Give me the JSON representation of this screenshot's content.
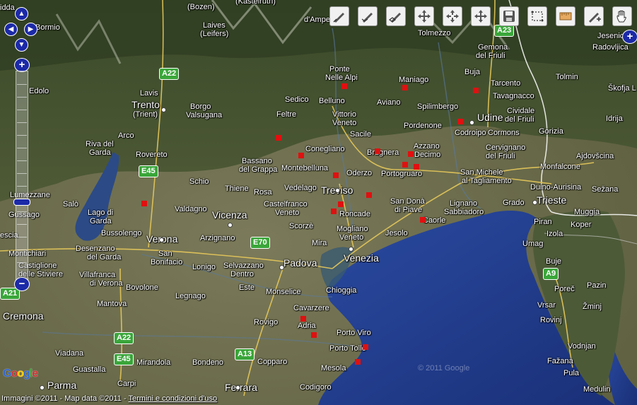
{
  "controls": {
    "pan_up": "▲",
    "pan_left": "◀",
    "pan_right": "▶",
    "pan_down": "▼",
    "zoom_in": "+",
    "zoom_out": "−",
    "overview_toggle": "+"
  },
  "toolbar_icons": [
    "draw-line-icon",
    "draw-polyline-icon",
    "draw-polygon-icon",
    "move-icon",
    "move-vertex-icon",
    "pan-icon",
    "save-icon",
    "select-box-icon",
    "ruler-icon",
    "add-point-icon",
    "hand-icon"
  ],
  "cities": [
    {
      "id": "bozen",
      "name": "(Bozen)"
    },
    {
      "id": "kastelruth",
      "name": "(Kastelruth)"
    },
    {
      "id": "idda",
      "name": "idda"
    },
    {
      "id": "laives",
      "name": "Laives"
    },
    {
      "id": "leifers",
      "name": "(Leifers)"
    },
    {
      "id": "ampezzo",
      "name": "d'Ampezzo"
    },
    {
      "id": "bormio",
      "name": "Bormio"
    },
    {
      "id": "tolmezzo",
      "name": "Tolmezzo"
    },
    {
      "id": "gemona",
      "name": "Gemona"
    },
    {
      "id": "delfriuli",
      "name": "del Friuli"
    },
    {
      "id": "jesenice",
      "name": "Jesenice"
    },
    {
      "id": "radovljica",
      "name": "Radovljica"
    },
    {
      "id": "ponte",
      "name": "Ponte"
    },
    {
      "id": "nellealpi",
      "name": "Nelle Alpi"
    },
    {
      "id": "maniago",
      "name": "Maniago"
    },
    {
      "id": "buja",
      "name": "Buja"
    },
    {
      "id": "tarcento",
      "name": "Tarcento"
    },
    {
      "id": "tolmin",
      "name": "Tolmin"
    },
    {
      "id": "tavagnacco",
      "name": "Tavagnacco"
    },
    {
      "id": "skofja",
      "name": "Škofja L"
    },
    {
      "id": "edolo",
      "name": "Edolo"
    },
    {
      "id": "lavis",
      "name": "Lavis"
    },
    {
      "id": "trento",
      "name": "Trento"
    },
    {
      "id": "trient",
      "name": "(Trient)"
    },
    {
      "id": "borgo",
      "name": "Borgo"
    },
    {
      "id": "valsugana",
      "name": "Valsugana"
    },
    {
      "id": "sedico",
      "name": "Sedico"
    },
    {
      "id": "belluno",
      "name": "Belluno"
    },
    {
      "id": "aviano",
      "name": "Aviano"
    },
    {
      "id": "spilimbergo",
      "name": "Spilimbergo"
    },
    {
      "id": "cividale",
      "name": "Cividale"
    },
    {
      "id": "delfriuli2",
      "name": "del Friuli"
    },
    {
      "id": "udine",
      "name": "Udine"
    },
    {
      "id": "idrija",
      "name": "Idrija"
    },
    {
      "id": "feltre",
      "name": "Feltre"
    },
    {
      "id": "vittorio",
      "name": "Vittorio"
    },
    {
      "id": "veneto1",
      "name": "Veneto"
    },
    {
      "id": "pordenone",
      "name": "Pordenone"
    },
    {
      "id": "codroipo",
      "name": "Codroipo"
    },
    {
      "id": "cormons",
      "name": "Cormons"
    },
    {
      "id": "gorizia",
      "name": "Gorizia"
    },
    {
      "id": "arco",
      "name": "Arco"
    },
    {
      "id": "sacile",
      "name": "Sacile"
    },
    {
      "id": "rivadelgarda",
      "name": "Riva del"
    },
    {
      "id": "garda1",
      "name": "Garda"
    },
    {
      "id": "rovereto",
      "name": "Rovereto"
    },
    {
      "id": "conegliano",
      "name": "Conegliano"
    },
    {
      "id": "brugnera",
      "name": "Brugnera"
    },
    {
      "id": "azzano",
      "name": "Azzano"
    },
    {
      "id": "decimo",
      "name": "Decimo"
    },
    {
      "id": "cervignano",
      "name": "Cervignano"
    },
    {
      "id": "delfriuli3",
      "name": "del Friuli"
    },
    {
      "id": "ajdovscina",
      "name": "Ajdovšcina"
    },
    {
      "id": "bassano",
      "name": "Bassano"
    },
    {
      "id": "delgrappa",
      "name": "del Grappa"
    },
    {
      "id": "montebelluna",
      "name": "Montebelluna"
    },
    {
      "id": "oderzo",
      "name": "Oderzo"
    },
    {
      "id": "portogruaro",
      "name": "Portogruaro"
    },
    {
      "id": "monfalcone",
      "name": "Monfalcone"
    },
    {
      "id": "sanmichele",
      "name": "San Michele"
    },
    {
      "id": "altagliamento",
      "name": "al Tagliamento"
    },
    {
      "id": "schio",
      "name": "Schio"
    },
    {
      "id": "thiene",
      "name": "Thiene"
    },
    {
      "id": "vedelago",
      "name": "Vedelago"
    },
    {
      "id": "treviso",
      "name": "Treviso"
    },
    {
      "id": "duinoaurisina",
      "name": "Duino-Aurisina"
    },
    {
      "id": "sezana",
      "name": "Sežana"
    },
    {
      "id": "lumezzane",
      "name": "Lumezzane"
    },
    {
      "id": "rosa",
      "name": "Rosa"
    },
    {
      "id": "castelfranco",
      "name": "Castelfranco"
    },
    {
      "id": "veneto2",
      "name": "Veneto"
    },
    {
      "id": "sandona",
      "name": "San Donà"
    },
    {
      "id": "dipiave",
      "name": "di Piave"
    },
    {
      "id": "lignano",
      "name": "Lignano"
    },
    {
      "id": "sabbiadoro",
      "name": "Sabbiadoro"
    },
    {
      "id": "grado",
      "name": "Grado"
    },
    {
      "id": "trieste",
      "name": "Trieste"
    },
    {
      "id": "salo",
      "name": "Salò"
    },
    {
      "id": "valdagno",
      "name": "Valdagno"
    },
    {
      "id": "vicenza",
      "name": "Vicenza"
    },
    {
      "id": "roncade",
      "name": "Roncade"
    },
    {
      "id": "muggia",
      "name": "Muggia"
    },
    {
      "id": "gussago",
      "name": "Gussago"
    },
    {
      "id": "lagodigarda1",
      "name": "Lago di"
    },
    {
      "id": "lagodigarda2",
      "name": "Garda"
    },
    {
      "id": "scorze",
      "name": "Scorzè"
    },
    {
      "id": "caorle",
      "name": "Caorle"
    },
    {
      "id": "piran",
      "name": "Piran"
    },
    {
      "id": "koper",
      "name": "Koper"
    },
    {
      "id": "bussolengo",
      "name": "Bussolengo"
    },
    {
      "id": "arzignano",
      "name": "Arzignano"
    },
    {
      "id": "mogliano",
      "name": "Mogliano"
    },
    {
      "id": "veneto3",
      "name": "Veneto"
    },
    {
      "id": "jesolo",
      "name": "Jesolo"
    },
    {
      "id": "izola",
      "name": "Izola"
    },
    {
      "id": "brescia",
      "name": "escia"
    },
    {
      "id": "verona",
      "name": "Verona"
    },
    {
      "id": "mira",
      "name": "Mira"
    },
    {
      "id": "umag",
      "name": "Umag"
    },
    {
      "id": "desenzano",
      "name": "Desenzano"
    },
    {
      "id": "delgarda",
      "name": "del Garda"
    },
    {
      "id": "sanbonifacio1",
      "name": "San"
    },
    {
      "id": "sanbonifacio2",
      "name": "Bonifacio"
    },
    {
      "id": "montichiari",
      "name": "Montichiari"
    },
    {
      "id": "castiglione",
      "name": "Castiglione"
    },
    {
      "id": "dellestiviere",
      "name": "delle Stiviere"
    },
    {
      "id": "lonigo",
      "name": "Lonigo"
    },
    {
      "id": "selvazzano",
      "name": "Selvazzano"
    },
    {
      "id": "dentro",
      "name": "Dentro"
    },
    {
      "id": "padova",
      "name": "Padova"
    },
    {
      "id": "venezia",
      "name": "Venezia"
    },
    {
      "id": "buje",
      "name": "Buje"
    },
    {
      "id": "villafranca",
      "name": "Villafranca"
    },
    {
      "id": "diverona",
      "name": "di Verona"
    },
    {
      "id": "bovolone",
      "name": "Bovolone"
    },
    {
      "id": "este",
      "name": "Este"
    },
    {
      "id": "monselice",
      "name": "Monselice"
    },
    {
      "id": "porec",
      "name": "Poreč"
    },
    {
      "id": "pazin",
      "name": "Pazin"
    },
    {
      "id": "legnago",
      "name": "Legnago"
    },
    {
      "id": "chioggia",
      "name": "Chioggia"
    },
    {
      "id": "mantova",
      "name": "Mantova"
    },
    {
      "id": "cremona",
      "name": "Cremona"
    },
    {
      "id": "vrsar",
      "name": "Vrsar"
    },
    {
      "id": "zminj",
      "name": "Žminj"
    },
    {
      "id": "cavarzere",
      "name": "Cavarzere"
    },
    {
      "id": "rovigo",
      "name": "Rovigo"
    },
    {
      "id": "rovinj",
      "name": "Rovinj"
    },
    {
      "id": "adria",
      "name": "Adria"
    },
    {
      "id": "portoviro",
      "name": "Porto Viro"
    },
    {
      "id": "vodnjan",
      "name": "Vodnjan"
    },
    {
      "id": "viadana",
      "name": "Viadana"
    },
    {
      "id": "portotolle",
      "name": "Porto Tolle"
    },
    {
      "id": "fazana",
      "name": "Fažana"
    },
    {
      "id": "guastalla",
      "name": "Guastalla"
    },
    {
      "id": "mirandola",
      "name": "Mirandola"
    },
    {
      "id": "bondeno",
      "name": "Bondeno"
    },
    {
      "id": "copparo",
      "name": "Copparo"
    },
    {
      "id": "mesola",
      "name": "Mesola"
    },
    {
      "id": "pula",
      "name": "Pula"
    },
    {
      "id": "parma",
      "name": "Parma"
    },
    {
      "id": "carpi",
      "name": "Carpi"
    },
    {
      "id": "ferrara",
      "name": "Ferrara"
    },
    {
      "id": "codigoro",
      "name": "Codigoro"
    },
    {
      "id": "medulin",
      "name": "Medulin"
    }
  ],
  "roads": [
    "A22",
    "A23",
    "E45",
    "E70",
    "A21",
    "A22",
    "E45",
    "A13",
    "A9"
  ],
  "watermark": "© 2011 Google",
  "logo": "Google",
  "copyright": {
    "imagery": "Immagini ©2011",
    "sep1": " - ",
    "mapdata": "Map data ©2011",
    "sep2": " - ",
    "terms": "Termini e condizioni d'uso"
  },
  "colors": {
    "marker": "#e01010",
    "control_blue": "#1c2aa8",
    "road_shield": "#3aa63a",
    "sea": "#1f3a8c"
  }
}
